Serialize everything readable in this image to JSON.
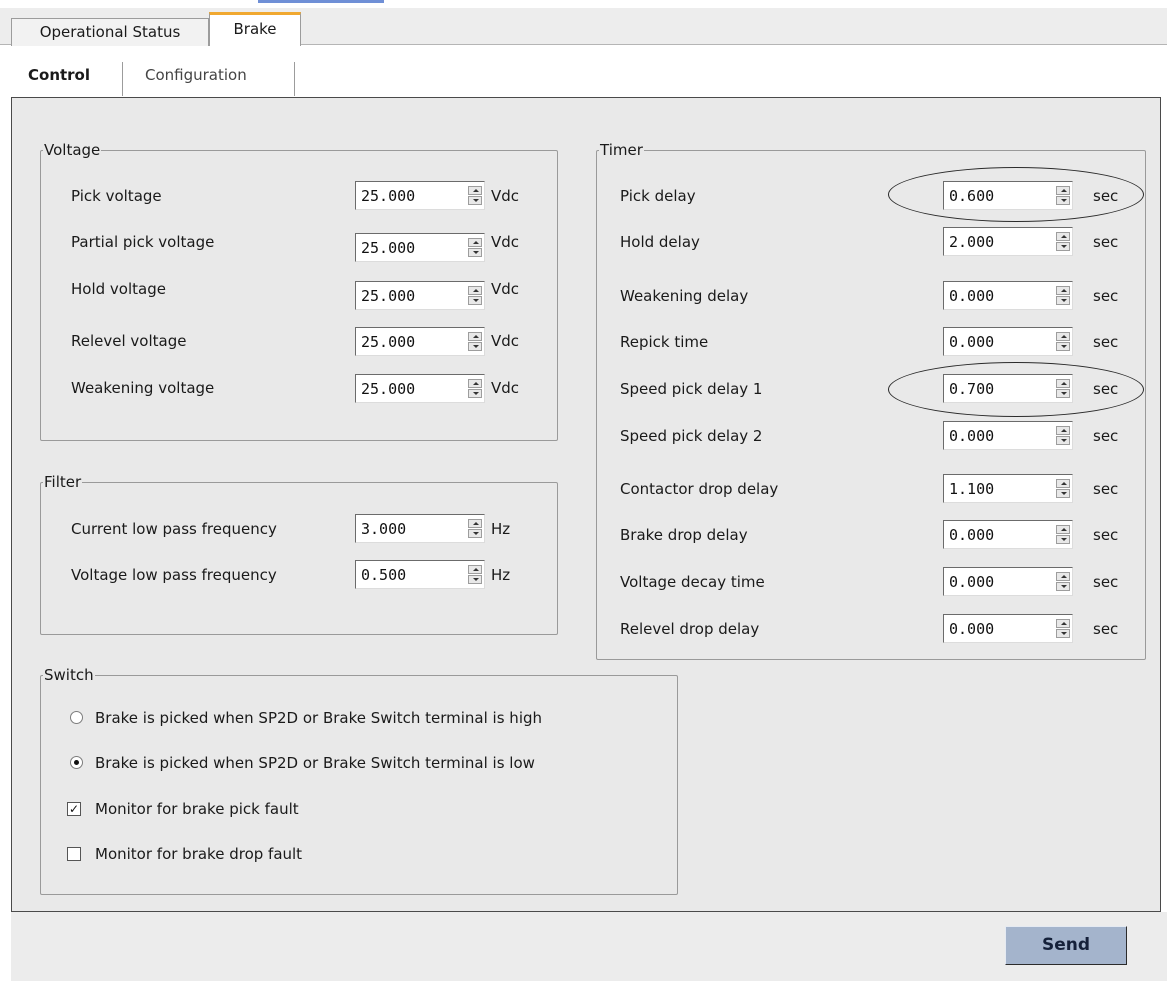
{
  "tabs": [
    "Operational Status",
    "Brake"
  ],
  "subtabs": [
    "Control",
    "Configuration"
  ],
  "voltage": {
    "title": "Voltage",
    "rows": [
      {
        "label": "Pick voltage",
        "value": "25.000",
        "unit": "Vdc"
      },
      {
        "label": "Partial pick voltage",
        "value": "25.000",
        "unit": "Vdc"
      },
      {
        "label": "Hold voltage",
        "value": "25.000",
        "unit": "Vdc"
      },
      {
        "label": "Relevel voltage",
        "value": "25.000",
        "unit": "Vdc"
      },
      {
        "label": "Weakening voltage",
        "value": "25.000",
        "unit": "Vdc"
      }
    ]
  },
  "filter": {
    "title": "Filter",
    "rows": [
      {
        "label": "Current low pass frequency",
        "value": "3.000",
        "unit": "Hz"
      },
      {
        "label": "Voltage low pass frequency",
        "value": "0.500",
        "unit": "Hz"
      }
    ]
  },
  "switch": {
    "title": "Switch",
    "radios": [
      {
        "label": "Brake is picked when SP2D or Brake Switch terminal is high",
        "checked": false
      },
      {
        "label": "Brake is picked when SP2D or Brake Switch terminal is low",
        "checked": true
      }
    ],
    "checks": [
      {
        "label": "Monitor for brake pick fault",
        "checked": true
      },
      {
        "label": "Monitor for brake drop fault",
        "checked": false
      }
    ]
  },
  "timer": {
    "title": "Timer",
    "rows": [
      {
        "label": "Pick delay",
        "value": "0.600",
        "unit": "sec"
      },
      {
        "label": "Hold delay",
        "value": "2.000",
        "unit": "sec"
      },
      {
        "label": "Weakening delay",
        "value": "0.000",
        "unit": "sec"
      },
      {
        "label": "Repick time",
        "value": "0.000",
        "unit": "sec"
      },
      {
        "label": "Speed pick delay 1",
        "value": "0.700",
        "unit": "sec"
      },
      {
        "label": "Speed pick delay 2",
        "value": "0.000",
        "unit": "sec"
      },
      {
        "label": "Contactor drop delay",
        "value": "1.100",
        "unit": "sec"
      },
      {
        "label": "Brake drop delay",
        "value": "0.000",
        "unit": "sec"
      },
      {
        "label": "Voltage decay time",
        "value": "0.000",
        "unit": "sec"
      },
      {
        "label": "Relevel drop delay",
        "value": "0.000",
        "unit": "sec"
      }
    ]
  },
  "send_label": "Send"
}
